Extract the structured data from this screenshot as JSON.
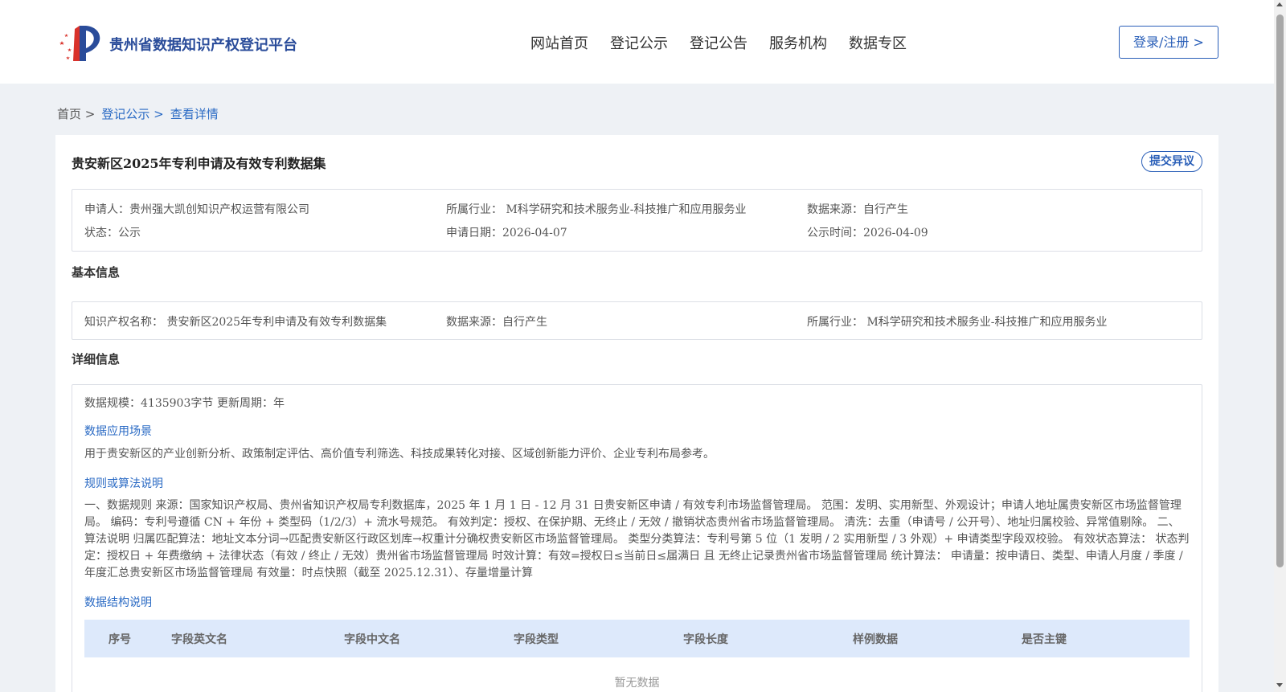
{
  "header": {
    "site_title": "贵州省数据知识产权登记平台",
    "nav": [
      "网站首页",
      "登记公示",
      "登记公告",
      "服务机构",
      "数据专区"
    ],
    "login_label": "登录/注册 >"
  },
  "breadcrumb": {
    "home": "首页 >",
    "registry": "登记公示 >",
    "detail": "查看详情"
  },
  "dataset": {
    "title": "贵安新区2025年专利申请及有效专利数据集",
    "objection_label": "提交异议",
    "summary": {
      "applicant": "申请人：贵州强大凯创知识产权运营有限公司",
      "industry": "所属行业： M科学研究和技术服务业-科技推广和应用服务业",
      "source": "数据来源：自行产生",
      "status": "状态：公示",
      "apply_date": "申请日期：2026-04-07",
      "publish_time": "公示时间：2026-04-09"
    }
  },
  "basic": {
    "section_title": "基本信息",
    "ip_name": "知识产权名称： 贵安新区2025年专利申请及有效专利数据集",
    "source": "数据来源：自行产生",
    "industry": "所属行业： M科学研究和技术服务业-科技推广和应用服务业"
  },
  "detail": {
    "section_title": "详细信息",
    "scale": "数据规模：4135903字节",
    "cycle": "更新周期：年",
    "scenario_title": "数据应用场景",
    "scenario_text": "用于贵安新区的产业创新分析、政策制定评估、高价值专利筛选、科技成果转化对接、区域创新能力评价、企业专利布局参考。",
    "rule_title": "规则或算法说明",
    "rule_text": "一、数据规则 来源：国家知识产权局、贵州省知识产权局专利数据库，2025 年 1 月 1 日 - 12 月 31 日贵安新区申请 / 有效专利市场监督管理局。 范围：发明、实用新型、外观设计；申请人地址属贵安新区市场监督管理局。 编码：专利号遵循 CN + 年份 + 类型码（1/2/3）+ 流水号规范。 有效判定：授权、在保护期、无终止 / 无效 / 撤销状态贵州省市场监督管理局。 清洗：去重（申请号 / 公开号）、地址归属校验、异常值剔除。 二、算法说明 归属匹配算法：地址文本分词→匹配贵安新区行政区划库→权重计分确权贵安新区市场监督管理局。 类型分类算法：专利号第 5 位（1 发明 / 2 实用新型 / 3 外观）+ 申请类型字段双校验。 有效状态算法： 状态判定：授权日 + 年费缴纳 + 法律状态（有效 / 终止 / 无效）贵州省市场监督管理局 时效计算：有效=授权日≤当前日≤届满日 且 无终止记录贵州省市场监督管理局 统计算法： 申请量：按申请日、类型、申请人月度 / 季度 / 年度汇总贵安新区市场监督管理局 有效量：时点快照（截至 2025.12.31）、存量增量计算",
    "structure_title": "数据结构说明",
    "table_headers": [
      "序号",
      "字段英文名",
      "字段中文名",
      "字段类型",
      "字段长度",
      "样例数据",
      "是否主键"
    ],
    "empty_text": "暂无数据"
  },
  "colors": {
    "accent": "#2a5fb8",
    "header_bg": "#ffffff",
    "page_bg": "#eef1f5",
    "table_head_bg": "#dde9fb"
  }
}
